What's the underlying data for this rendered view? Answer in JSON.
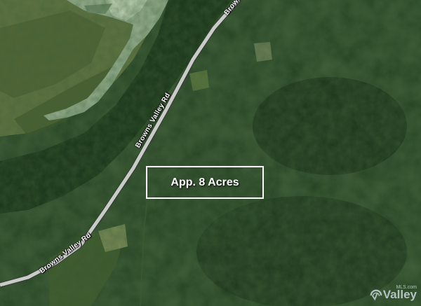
{
  "map": {
    "road_labels": [
      "Browns Valley Rd",
      "Browns Valley Rd",
      "Browns"
    ],
    "parcel_label": "App. 8 Acres",
    "watermark": {
      "text": "Valley",
      "sub": "MLS.com"
    },
    "colors": {
      "forest_dark": "#152c17",
      "forest_mid": "#24421f",
      "field": "#6c7d4a",
      "river": "#a9c2a1",
      "road": "#c9cbc8",
      "label": "#ffffff"
    }
  }
}
